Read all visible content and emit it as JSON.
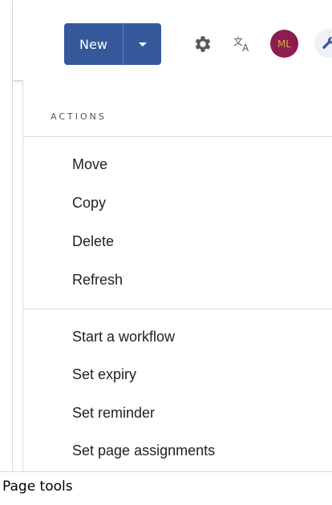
{
  "toolbar": {
    "new_label": "New",
    "new_dropdown_icon": "caret-down-icon",
    "settings_icon": "gear-icon",
    "translate_icon": "translate-icon",
    "avatar_initials": "ML",
    "tools_icon": "wrench-icon",
    "colors": {
      "primary": "#36599c",
      "avatar": "#8b1e4f",
      "avatar_text": "#d9a64a"
    }
  },
  "menu": {
    "section_title": "ACTIONS",
    "items_group1": [
      "Move",
      "Copy",
      "Delete",
      "Refresh"
    ],
    "items_group2": [
      "Start a workflow",
      "Set expiry",
      "Set reminder",
      "Set page assignments"
    ]
  },
  "footer": {
    "caption": "Page tools"
  }
}
